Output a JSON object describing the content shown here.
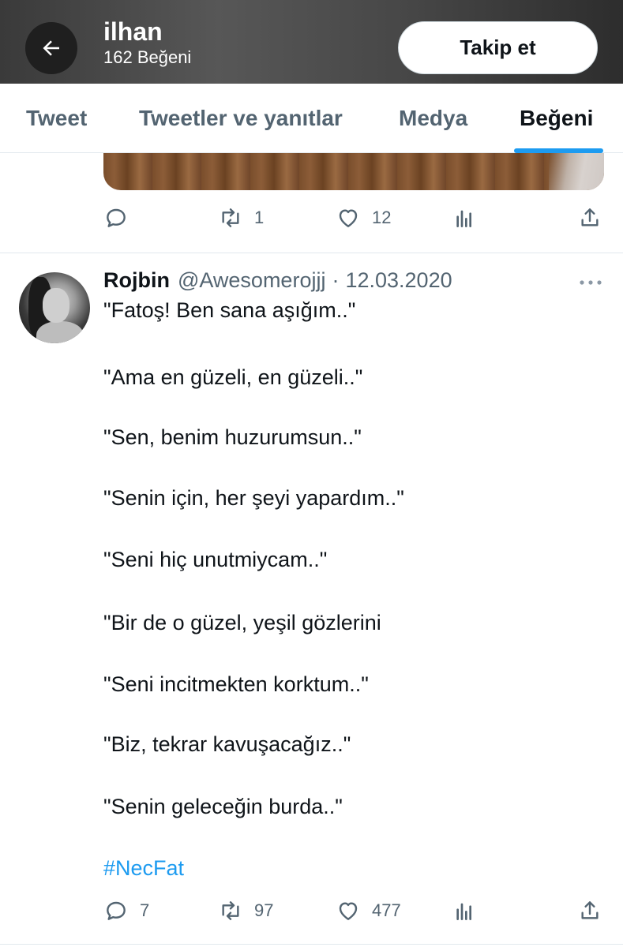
{
  "header": {
    "name": "ilhan",
    "likes_label": "162 Beğeni",
    "follow_label": "Takip et"
  },
  "tabs": [
    {
      "label": "Tweet",
      "active": false
    },
    {
      "label": "Tweetler ve yanıtlar",
      "active": false
    },
    {
      "label": "Medya",
      "active": false
    },
    {
      "label": "Beğeni",
      "active": true
    }
  ],
  "previous_tweet": {
    "retweets": "1",
    "likes": "12"
  },
  "tweet": {
    "author_name": "Rojbin",
    "author_handle": "@Awesomerojjj",
    "separator": "·",
    "date": "12.03.2020",
    "lines": [
      "\"Fatoş! Ben sana aşığım..\"",
      "\"Ama en güzeli, en güzeli..\"",
      "\"Sen, benim huzurumsun..\"",
      "\"Senin için, her şeyi yapardım..\"",
      "\"Seni hiç unutmiycam..\"",
      "\"Bir de o güzel, yeşil gözlerini",
      "\"Seni incitmekten korktum..\"",
      "\"Biz, tekrar kavuşacağız..\"",
      "\"Senin geleceğin burda..\""
    ],
    "hashtag": "#NecFat",
    "replies": "7",
    "retweets": "97",
    "likes": "477"
  },
  "icons": {
    "back": "arrow-left-icon",
    "reply": "reply-icon",
    "retweet": "retweet-icon",
    "like": "heart-icon",
    "analytics": "analytics-icon",
    "share": "share-icon",
    "more": "more-icon"
  },
  "colors": {
    "accent": "#1d9bf0",
    "text": "#0f1419",
    "secondary": "#536471",
    "divider": "#e1e8ed"
  }
}
